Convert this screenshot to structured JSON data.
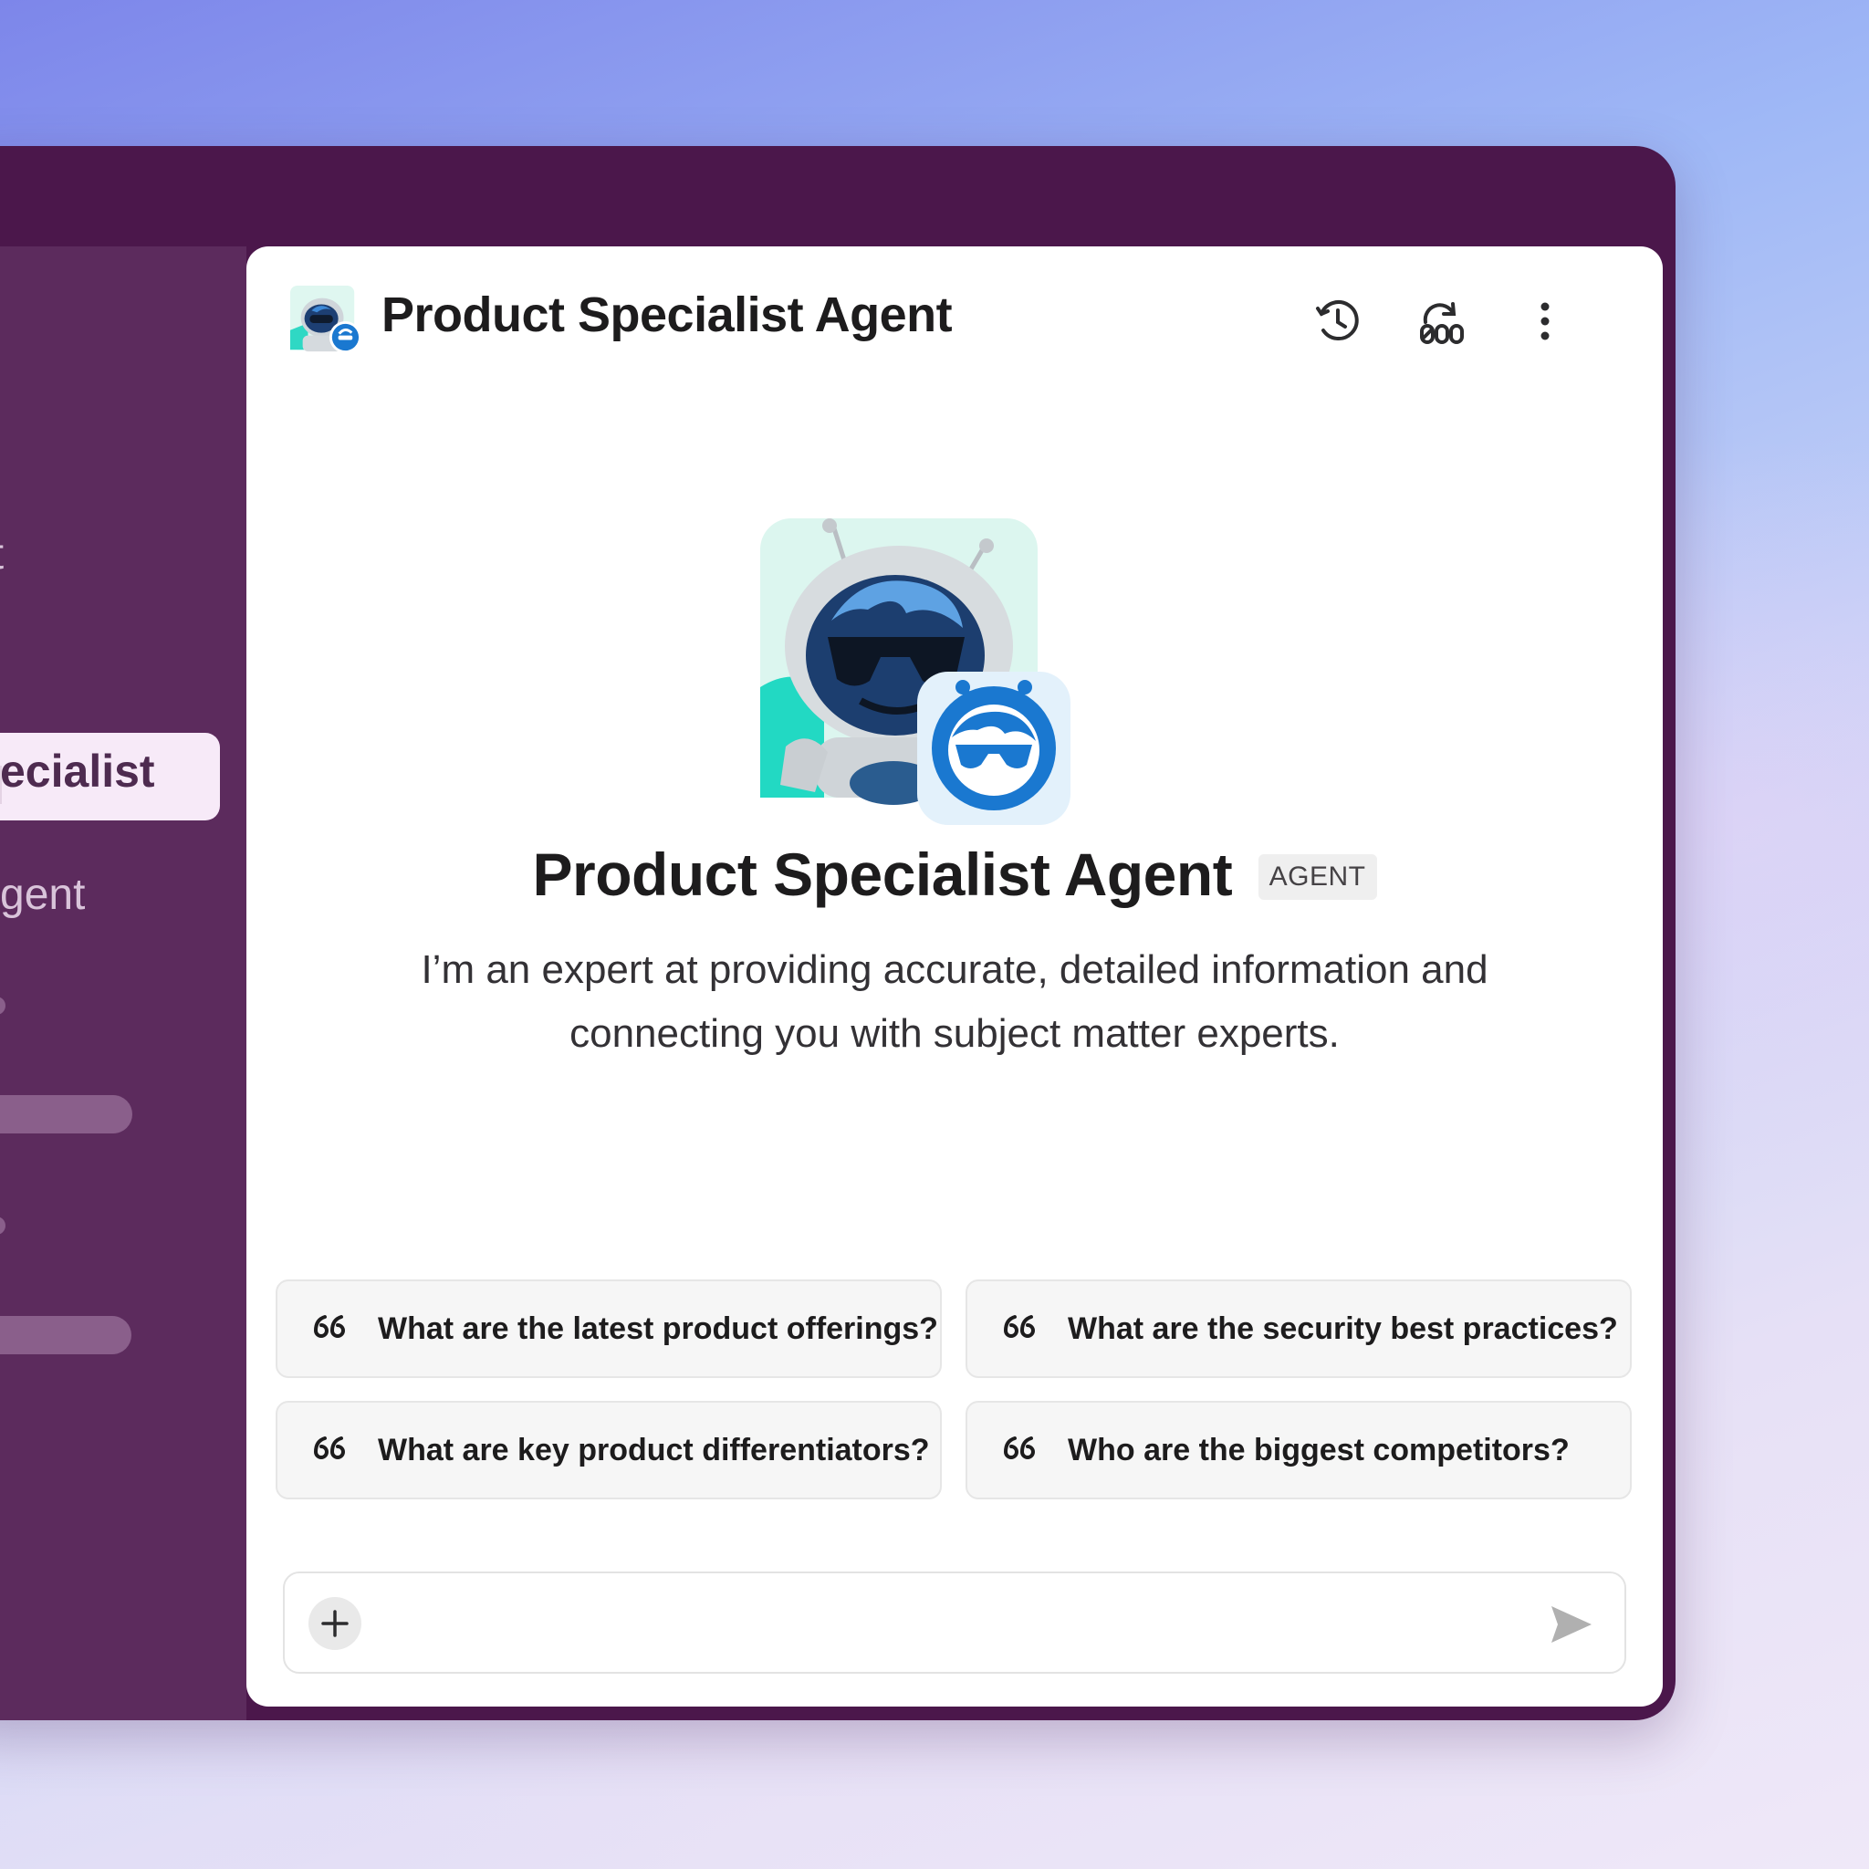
{
  "sidebar": {
    "items": [
      {
        "label": "nt"
      },
      {
        "label": "ecialist",
        "active": true
      },
      {
        "label": "gent"
      }
    ]
  },
  "header": {
    "title": "Product Specialist Agent",
    "icons": [
      "history-icon",
      "refresh-icon",
      "more-options-icon"
    ]
  },
  "hero": {
    "title": "Product Specialist Agent",
    "badge": "AGENT",
    "description": "I’m an expert at providing accurate, detailed information and connecting you with subject matter experts."
  },
  "prompts": [
    {
      "text": "What are the latest product offerings?"
    },
    {
      "text": "What are the security best practices?"
    },
    {
      "text": "What are key product differentiators?"
    },
    {
      "text": "Who are the biggest competitors?"
    }
  ],
  "composer": {
    "placeholder": ""
  },
  "colors": {
    "window": "#4b174b",
    "sidebar": "#5c2b5d",
    "active_item": "#f7eaf8",
    "brand_blue": "#1a78d0",
    "teal": "#2fd8c4"
  }
}
